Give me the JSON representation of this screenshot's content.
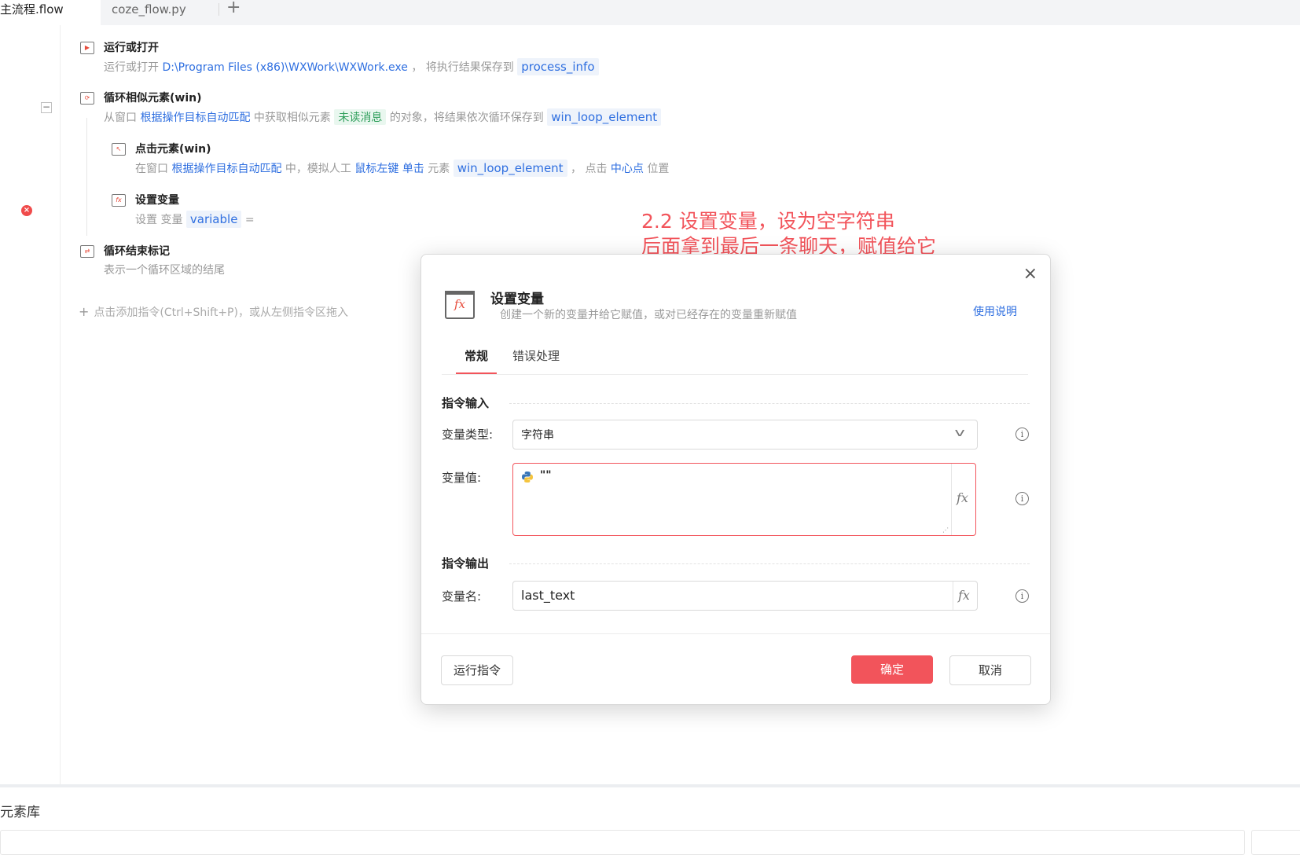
{
  "tabs": {
    "active": "主流程.flow",
    "second": "coze_flow.py",
    "add": "+"
  },
  "steps": [
    {
      "title": "运行或打开",
      "desc_prefix": "运行或打开",
      "path": "D:\\Program Files (x86)\\WXWork\\WXWork.exe",
      "desc_mid": "， 将执行结果保存到",
      "var": "process_info"
    },
    {
      "title": "循环相似元素(win)",
      "p1": "从窗口",
      "match": "根据操作目标自动匹配",
      "p2": "中获取相似元素",
      "element": "未读消息",
      "p3": "的对象，将结果依次循环保存到",
      "var": "win_loop_element"
    },
    {
      "title": "点击元素(win)",
      "p1": "在窗口",
      "match": "根据操作目标自动匹配",
      "p2": "中，模拟人工",
      "button": "鼠标左键",
      "click": "单击",
      "p3": "元素",
      "var": "win_loop_element",
      "p4": "， 点击",
      "pos": "中心点",
      "p5": "位置"
    },
    {
      "title": "设置变量",
      "p1": "设置 变量",
      "var": "variable",
      "eq": "="
    },
    {
      "title": "循环结束标记",
      "desc": "表示一个循环区域的结尾"
    }
  ],
  "collapse_symbol": "−",
  "error_symbol": "×",
  "add_hint": "点击添加指令(Ctrl+Shift+P)，或从左侧指令区拖入",
  "annotation": {
    "line1": "2.2 设置变量，设为空字符串",
    "line2": "后面拿到最后一条聊天，赋值给它"
  },
  "modal": {
    "title": "设置变量",
    "subtitle": "创建一个新的变量并给它赋值，或对已经存在的变量重新赋值",
    "help": "使用说明",
    "close": "×",
    "tabs": [
      "常规",
      "错误处理"
    ],
    "input_section": "指令输入",
    "type_label": "变量类型:",
    "type_value": "字符串",
    "value_label": "变量值:",
    "value": "\"\"",
    "output_section": "指令输出",
    "name_label": "变量名:",
    "name_value": "last_text",
    "fx": "fx",
    "run_btn": "运行指令",
    "ok_btn": "确定",
    "cancel_btn": "取消"
  },
  "bottom": {
    "title": "元素库"
  },
  "colors": {
    "accent": "#f2545b",
    "link": "#2f6fe0"
  }
}
